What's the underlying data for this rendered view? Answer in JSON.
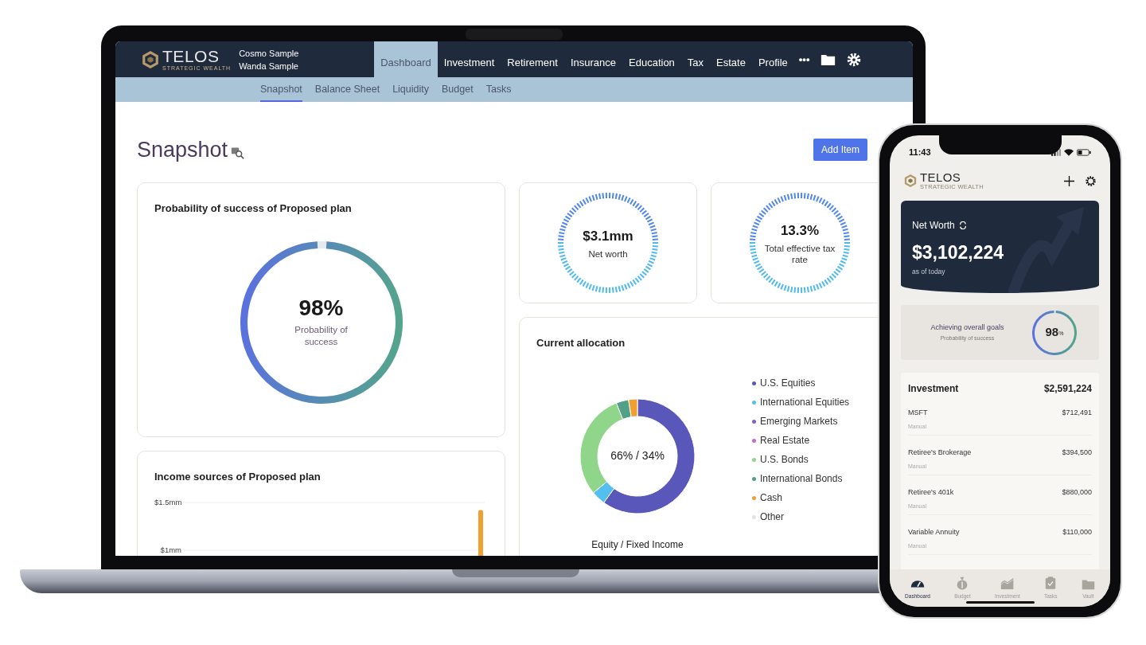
{
  "laptop": {
    "header": {
      "logo": {
        "name": "TELOS",
        "tagline": "STRATEGIC WEALTH"
      },
      "clients": [
        "Cosmo Sample",
        "Wanda Sample"
      ],
      "nav": [
        {
          "label": "Dashboard",
          "selected": true
        },
        {
          "label": "Investment",
          "selected": false
        },
        {
          "label": "Retirement",
          "selected": false
        },
        {
          "label": "Insurance",
          "selected": false
        },
        {
          "label": "Education",
          "selected": false
        },
        {
          "label": "Tax",
          "selected": false
        },
        {
          "label": "Estate",
          "selected": false
        },
        {
          "label": "Profile",
          "selected": false
        }
      ],
      "more": "•••"
    },
    "subnav": [
      {
        "label": "Snapshot",
        "selected": true
      },
      {
        "label": "Balance Sheet",
        "selected": false
      },
      {
        "label": "Liquidity",
        "selected": false
      },
      {
        "label": "Budget",
        "selected": false
      },
      {
        "label": "Tasks",
        "selected": false
      }
    ],
    "page_title": "Snapshot",
    "add_button": "Add Item",
    "probability_card": {
      "title": "Probability of success of Proposed plan",
      "value": "98%",
      "caption": "Probability of success"
    },
    "income_card": {
      "title": "Income sources of Proposed plan",
      "chart_data": {
        "type": "bar",
        "ylim": [
          1,
          1.5
        ],
        "yticks": [
          {
            "value": 1.5,
            "label": "$1.5mm"
          },
          {
            "value": 1,
            "label": "$1mm"
          }
        ],
        "values": [
          1.42
        ],
        "color": "#f0a030"
      }
    },
    "stat_cards": [
      {
        "value": "$3.1mm",
        "caption": "Net worth"
      },
      {
        "value": "13.3%",
        "caption": "Total effective tax rate"
      }
    ],
    "allocation_card": {
      "title": "Current allocation",
      "center": "66% / 34%",
      "caption": "Equity / Fixed Income",
      "legend": [
        {
          "label": "U.S. Equities",
          "color": "#5a57bb"
        },
        {
          "label": "International Equities",
          "color": "#53bfee"
        },
        {
          "label": "Emerging Markets",
          "color": "#8a5cc8"
        },
        {
          "label": "Real Estate",
          "color": "#c06cc8"
        },
        {
          "label": "U.S. Bonds",
          "color": "#8fd68a"
        },
        {
          "label": "International Bonds",
          "color": "#52a088"
        },
        {
          "label": "Cash",
          "color": "#f0a030"
        },
        {
          "label": "Other",
          "color": "#e2e2e2"
        }
      ]
    }
  },
  "phone": {
    "time": "11:43",
    "logo": {
      "name": "TELOS",
      "tagline": "STRATEGIC WEALTH"
    },
    "net_worth": {
      "label": "Net Worth",
      "value": "$3,102,224",
      "caption": "as of today"
    },
    "goals": {
      "title": "Achieving overall goals",
      "subtitle": "Probability of success",
      "value": "98",
      "unit": "%"
    },
    "investment": {
      "title": "Investment",
      "total": "$2,591,224",
      "rows": [
        {
          "name": "MSFT",
          "source": "Manual",
          "amount": "$712,491"
        },
        {
          "name": "Retiree's Brokerage",
          "source": "Manual",
          "amount": "$394,500"
        },
        {
          "name": "Retiree's 401k",
          "source": "Manual",
          "amount": "$880,000"
        },
        {
          "name": "Variable Annuity",
          "source": "Manual",
          "amount": "$110,000"
        }
      ]
    },
    "tabs": [
      {
        "label": "Dashboard",
        "selected": true,
        "kind": "gauge"
      },
      {
        "label": "Budget",
        "selected": false,
        "kind": "moneybag"
      },
      {
        "label": "Investment",
        "selected": false,
        "kind": "chart"
      },
      {
        "label": "Tasks",
        "selected": false,
        "kind": "clipboard"
      },
      {
        "label": "Vault",
        "selected": false,
        "kind": "folder"
      }
    ]
  }
}
